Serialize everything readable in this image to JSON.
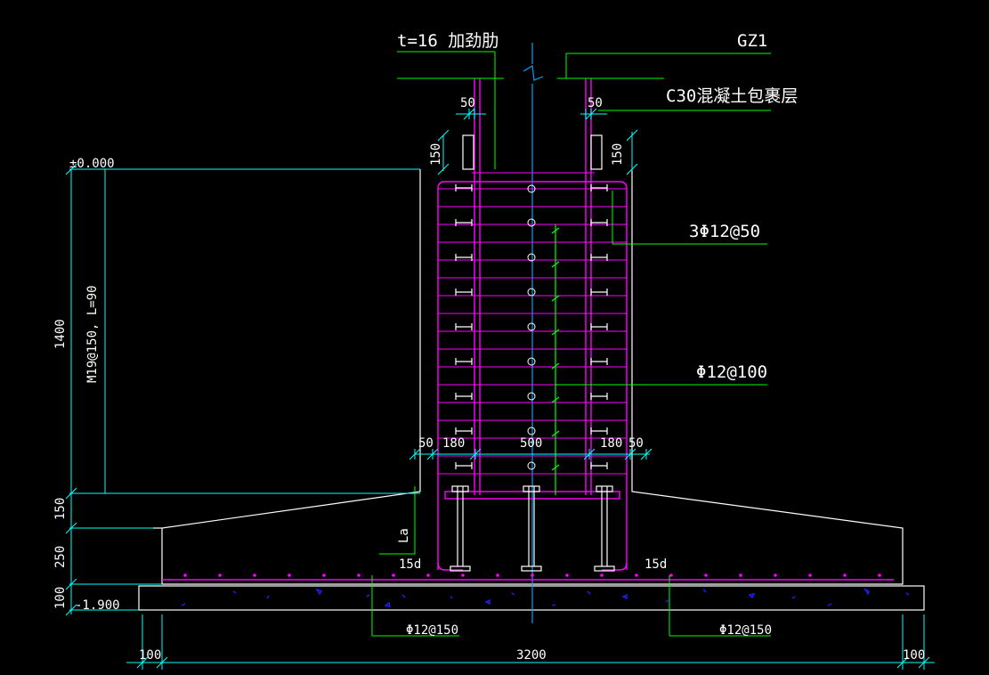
{
  "labels": {
    "rib": "t=16  加劲肋",
    "column": "GZ1",
    "encasement": "C30混凝土包裹层",
    "stirrup": "3Φ12@50",
    "longitudinal": "Φ12@100",
    "bolt": "M19@150, L=90",
    "elev_top": "±0.000",
    "elev_bottom": "-1.900",
    "anchor": "La",
    "hook_left": "15d",
    "hook_right": "15d",
    "bottom_bar_left": "Φ12@150",
    "bottom_bar_right": "Φ12@150"
  },
  "dims": {
    "d50_top_left": "50",
    "d50_top_right": "50",
    "d150_left": "150",
    "d150_right": "150",
    "d50_mid_left": "50",
    "d180_left": "180",
    "d500": "500",
    "d180_right": "180",
    "d50_mid_right": "50",
    "d1400": "1400",
    "d150_v": "150",
    "d250": "250",
    "d100_v": "100",
    "d100_bl": "100",
    "d3200": "3200",
    "d100_br": "100"
  },
  "colors": {
    "background": "#000000",
    "outline": "#ffffff",
    "leader": "#00ff00",
    "dimension": "#00ffff",
    "rebar": "#ff00ff",
    "centerline": "#00a0ff",
    "aggregate": "#2020ff"
  }
}
